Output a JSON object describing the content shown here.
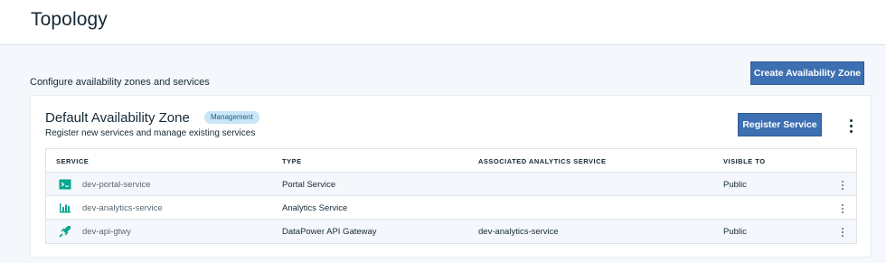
{
  "page": {
    "title": "Topology",
    "subtitle": "Configure availability zones and services",
    "create_zone_label": "Create Availability Zone"
  },
  "zone": {
    "title": "Default Availability Zone",
    "badge": "Management",
    "description": "Register new services and manage existing services",
    "register_label": "Register Service",
    "table": {
      "headers": [
        "SERVICE",
        "TYPE",
        "ASSOCIATED ANALYTICS SERVICE",
        "VISIBLE TO"
      ],
      "rows": [
        {
          "icon": "portal-service-icon",
          "service": "dev-portal-service",
          "type": "Portal Service",
          "analytics": "",
          "visible_to": "Public"
        },
        {
          "icon": "analytics-service-icon",
          "service": "dev-analytics-service",
          "type": "Analytics Service",
          "analytics": "",
          "visible_to": ""
        },
        {
          "icon": "gateway-service-icon",
          "service": "dev-api-gtwy",
          "type": "DataPower API Gateway",
          "analytics": "dev-analytics-service",
          "visible_to": "Public"
        }
      ]
    }
  },
  "colors": {
    "primary_button": "#3d70b2",
    "portal_icon": "#00a68f",
    "analytics_icon": "#00a68f",
    "gateway_icon": "#00a68f",
    "badge_bg": "#c8e6f7"
  }
}
